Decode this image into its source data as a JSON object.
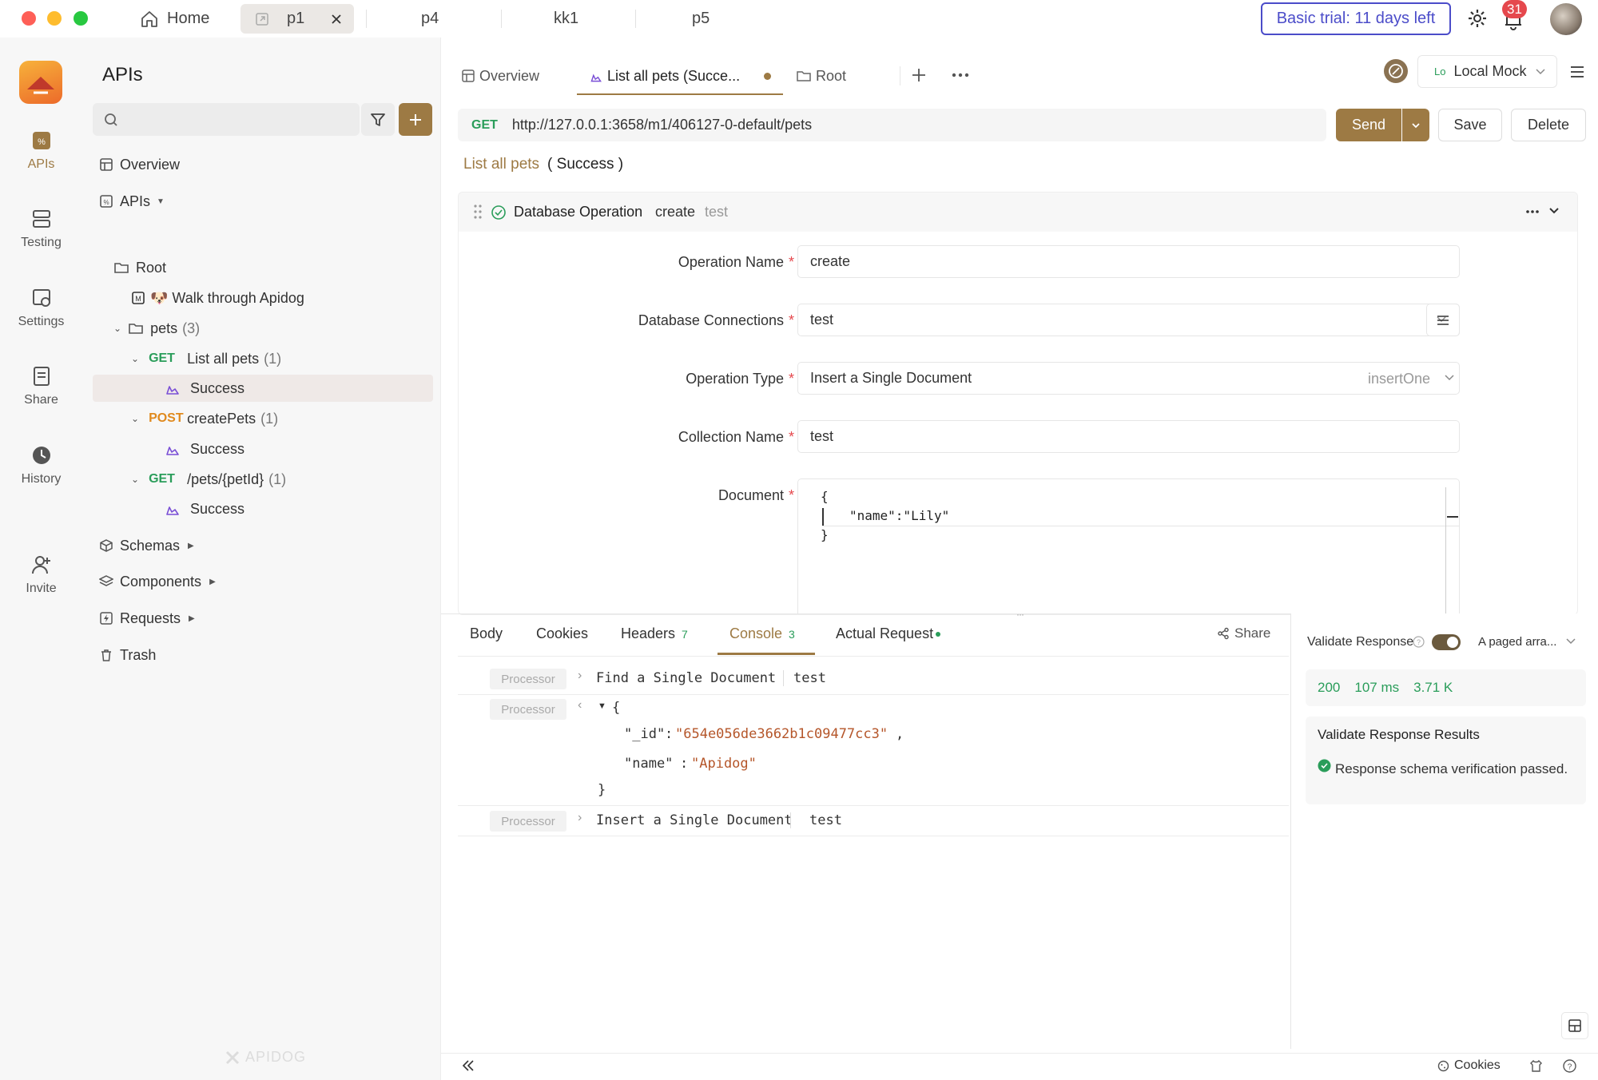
{
  "titlebar": {
    "home_label": "Home",
    "tabs": [
      "p1",
      "p4",
      "kk1",
      "p5"
    ],
    "trial_label": "Basic trial: 11 days left",
    "notification_count": "31"
  },
  "rail": {
    "items": [
      {
        "label": "APIs",
        "icon": "apis-icon"
      },
      {
        "label": "Testing",
        "icon": "testing-icon"
      },
      {
        "label": "Settings",
        "icon": "settings-icon"
      },
      {
        "label": "Share",
        "icon": "share-icon"
      },
      {
        "label": "History",
        "icon": "history-icon"
      },
      {
        "label": "Invite",
        "icon": "invite-icon"
      }
    ]
  },
  "sidebar": {
    "title": "APIs",
    "search_placeholder": "",
    "overview": "Overview",
    "apis": "APIs",
    "root": "Root",
    "walk_through": "🐶 Walk through Apidog",
    "pets": {
      "label": "pets",
      "count": "(3)"
    },
    "endpoints": [
      {
        "method": "GET",
        "name": "List all pets",
        "count": "(1)",
        "child": "Success"
      },
      {
        "method": "POST",
        "name": "createPets",
        "count": "(1)",
        "child": "Success"
      },
      {
        "method": "GET",
        "name": "/pets/{petId}",
        "count": "(1)",
        "child": "Success"
      }
    ],
    "schemas": "Schemas",
    "components": "Components",
    "requests": "Requests",
    "trash": "Trash",
    "watermark": "APIDOG"
  },
  "main_tabs": {
    "overview": "Overview",
    "active": "List all pets (Succe...",
    "root": "Root",
    "env": "Local Mock",
    "env_prefix": "Lo"
  },
  "request": {
    "method": "GET",
    "url": "http://127.0.0.1:3658/m1/406127-0-default/pets",
    "send": "Send",
    "save": "Save",
    "delete": "Delete",
    "breadcrumb_link": "List all pets",
    "breadcrumb_case": "( Success )"
  },
  "db_operation": {
    "title": "Database Operation",
    "op": "create",
    "conn": "test",
    "fields": {
      "operation_name_label": "Operation Name",
      "operation_name_value": "create",
      "db_connections_label": "Database Connections",
      "db_connections_value": "test",
      "operation_type_label": "Operation Type",
      "operation_type_value": "Insert a Single Document",
      "operation_type_code": "insertOne",
      "collection_label": "Collection Name",
      "collection_value": "test",
      "document_label": "Document",
      "document_lines": [
        "{",
        "\"name\":\"Lily\"",
        "}"
      ]
    }
  },
  "response": {
    "tabs": {
      "body": "Body",
      "cookies": "Cookies",
      "headers": "Headers",
      "headers_count": "7",
      "console": "Console",
      "console_count": "3",
      "actual": "Actual Request"
    },
    "share": "Share",
    "console_lines": [
      {
        "tag": "Processor",
        "text": "Find a Single Document",
        "arg": "test"
      },
      {
        "tag": "Processor",
        "json_open": "{",
        "id_key": "\"_id\"",
        "id_val": "\"654e056de3662b1c09477cc3\"",
        "name_key": "\"name\"",
        "name_val": "\"Apidog\"",
        "json_close": "}"
      },
      {
        "tag": "Processor",
        "text": "Insert a Single Document",
        "arg": "test"
      }
    ]
  },
  "validate": {
    "label": "Validate Response",
    "schema": "A paged arra...",
    "status": "200",
    "time": "107 ms",
    "size": "3.71 K",
    "results_title": "Validate Response Results",
    "result_text": "Response schema verification passed."
  },
  "statusbar": {
    "cookies": "Cookies"
  },
  "colors": {
    "accent": "#9d7a44",
    "get": "#2a9d5a",
    "post": "#e08a1e",
    "trial": "#4b4cc9",
    "badge": "#e5484d"
  }
}
